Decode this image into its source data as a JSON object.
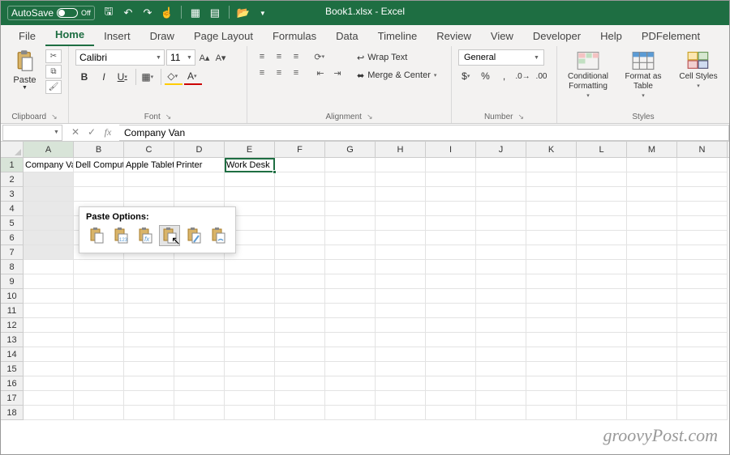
{
  "title": {
    "filename": "Book1.xlsx",
    "appname": "Excel",
    "full": "Book1.xlsx - Excel"
  },
  "autosave": {
    "label": "AutoSave",
    "state": "Off"
  },
  "qat": [
    "save",
    "undo",
    "redo",
    "touch",
    "sep",
    "borders",
    "table",
    "sep",
    "open"
  ],
  "tabs": [
    "File",
    "Home",
    "Insert",
    "Draw",
    "Page Layout",
    "Formulas",
    "Data",
    "Timeline",
    "Review",
    "View",
    "Developer",
    "Help",
    "PDFelement"
  ],
  "active_tab": "Home",
  "ribbon": {
    "clipboard": {
      "label": "Clipboard",
      "paste": "Paste"
    },
    "font": {
      "label": "Font",
      "name": "Calibri",
      "size": "11"
    },
    "alignment": {
      "label": "Alignment",
      "wrap": "Wrap Text",
      "merge": "Merge & Center"
    },
    "number": {
      "label": "Number",
      "format": "General"
    },
    "styles": {
      "label": "Styles",
      "cond": "Conditional Formatting",
      "table": "Format as Table",
      "cell": "Cell Styles"
    }
  },
  "formula_bar": {
    "name_box": "",
    "value": "Company Van"
  },
  "columns": [
    "A",
    "B",
    "C",
    "D",
    "E",
    "F",
    "G",
    "H",
    "I",
    "J",
    "K",
    "L",
    "M",
    "N"
  ],
  "row_count": 18,
  "cells": {
    "A1": "Company Van",
    "B1": "Dell Computer",
    "C1": "Apple Tablet",
    "D1": "Printer",
    "E1": "Work Desk"
  },
  "paste_options": {
    "title": "Paste Options:",
    "items": [
      "paste",
      "values",
      "formulas",
      "transpose",
      "formatting",
      "link"
    ]
  },
  "watermark": "groovyPost.com"
}
